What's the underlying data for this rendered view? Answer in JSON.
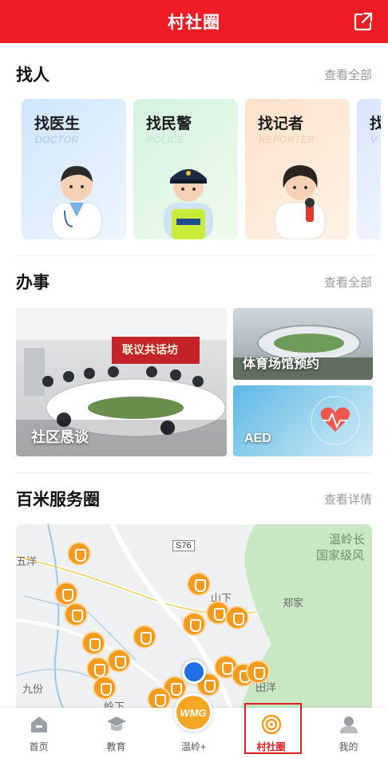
{
  "header": {
    "title": "村社圈"
  },
  "find_people": {
    "title": "找人",
    "more": "查看全部",
    "cards": [
      {
        "name": "找医生",
        "sub": "DOCTOR"
      },
      {
        "name": "找民警",
        "sub": "POLICE"
      },
      {
        "name": "找记者",
        "sub": "REPORTER"
      },
      {
        "name": "找",
        "sub": "V"
      }
    ]
  },
  "affairs": {
    "title": "办事",
    "more": "查看全部",
    "tiles": {
      "community_talk": "社区恳谈",
      "banner_text": "联议共话坊",
      "stadium": "体育场馆预约",
      "aed": "AED"
    }
  },
  "service_circle": {
    "title": "百米服务圈",
    "more": "查看详情",
    "map_labels": {
      "road": "S76",
      "top_right_1": "温岭长",
      "top_right_2": "国家级风",
      "zhengjia": "郑家",
      "shanxia": "山下",
      "wuyang": "五洋",
      "jiufen": "九份",
      "lingxia": "岭下",
      "tianyang": "田洋"
    }
  },
  "tabbar": {
    "items": [
      {
        "label": "首页"
      },
      {
        "label": "教育"
      },
      {
        "label": "温岭+"
      },
      {
        "label": "村社圈"
      },
      {
        "label": "我的"
      }
    ],
    "center_logo": "WMG"
  },
  "colors": {
    "brand": "#ee1c25",
    "pin": "#f39b1e"
  }
}
